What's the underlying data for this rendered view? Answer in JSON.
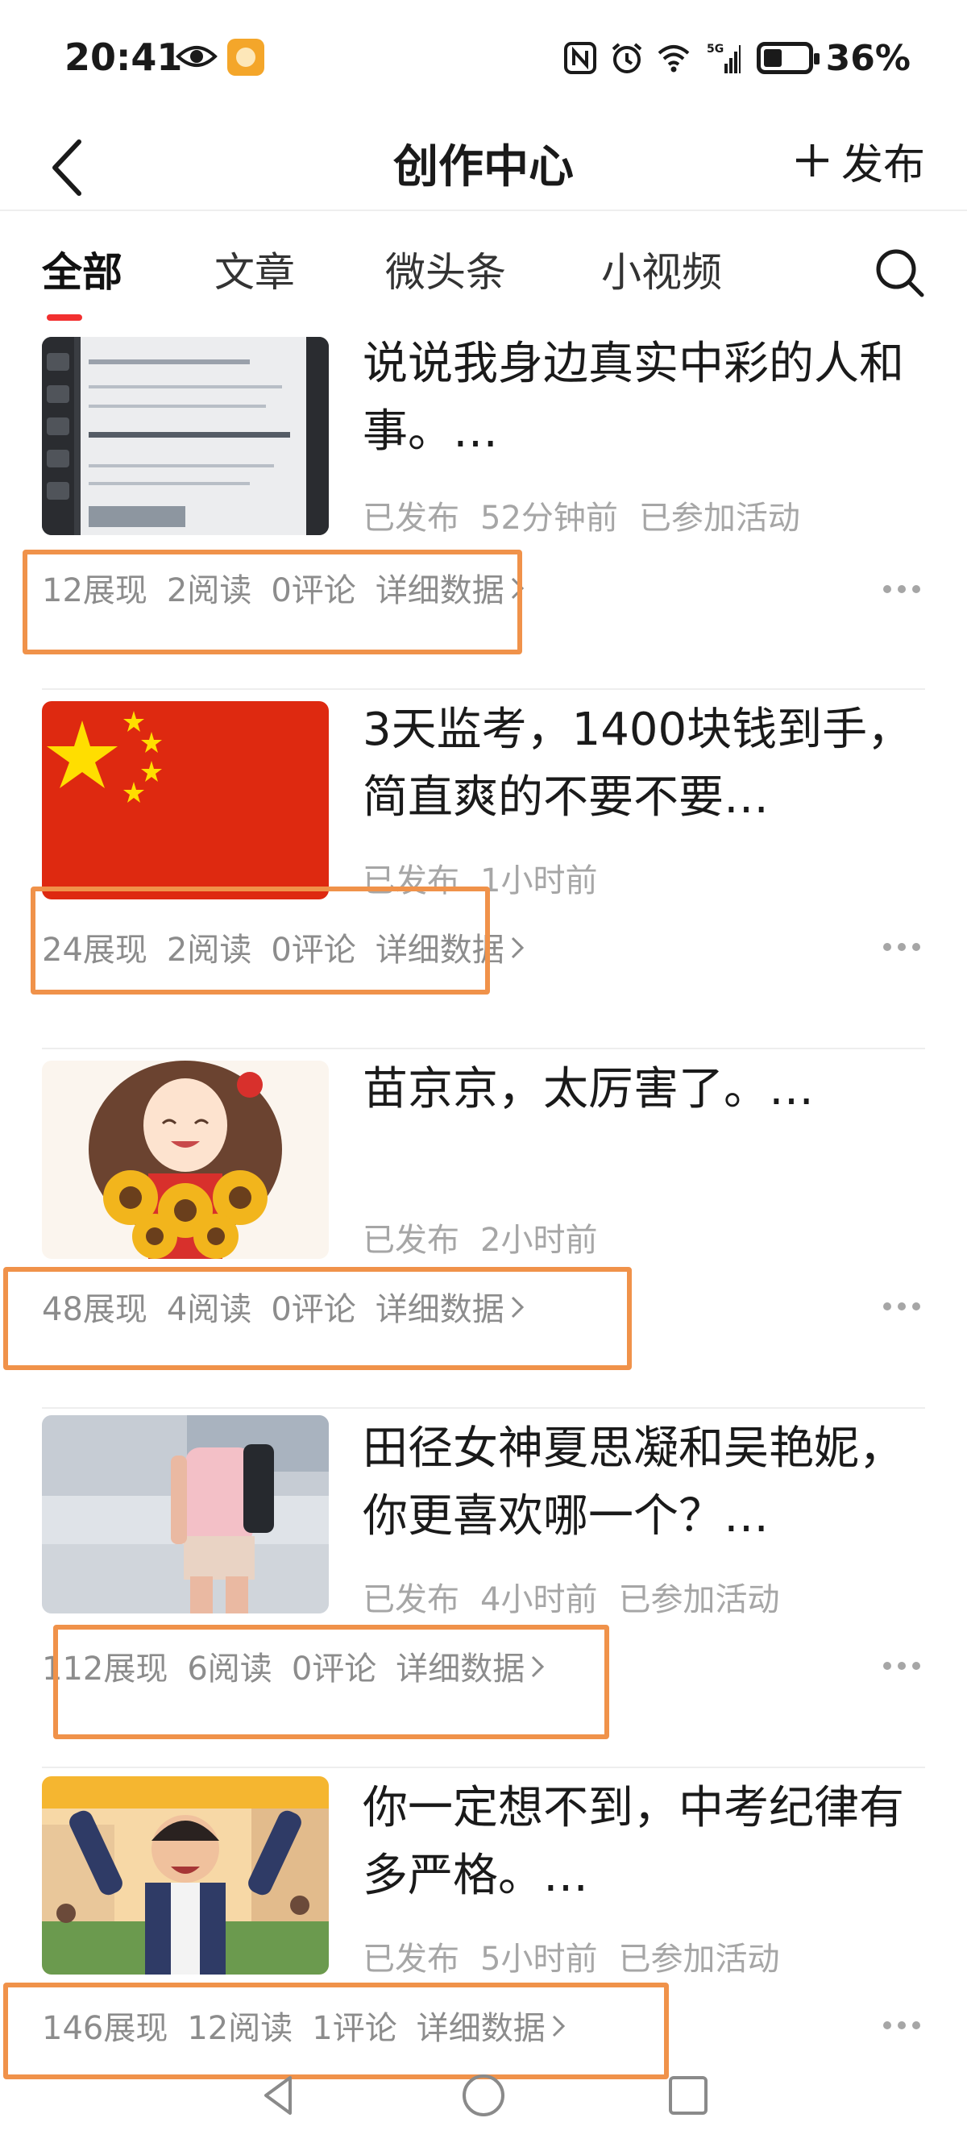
{
  "status_bar": {
    "time": "20:41",
    "battery": "36%",
    "network": "5G",
    "icons": [
      "eye-icon",
      "app-notification-icon",
      "nfc-icon",
      "alarm-icon",
      "wifi-icon",
      "signal-icon",
      "battery-icon"
    ]
  },
  "header": {
    "title": "创作中心",
    "publish_label": "发布"
  },
  "tabs": [
    {
      "label": "全部",
      "active": true
    },
    {
      "label": "文章",
      "active": false
    },
    {
      "label": "微头条",
      "active": false
    },
    {
      "label": "小视频",
      "active": false
    }
  ],
  "articles": [
    {
      "title": "说说我身边真实中彩的人和事。…",
      "status": "已发布",
      "time": "52分钟前",
      "activity": "已参加活动",
      "impressions": "12展现",
      "reads": "2阅读",
      "comments": "0评论",
      "details_link": "详细数据",
      "thumbnail": "lottery-ticket"
    },
    {
      "title": "3天监考，1400块钱到手，简直爽的不要不要…",
      "status": "已发布",
      "time": "1小时前",
      "activity": "",
      "impressions": "24展现",
      "reads": "2阅读",
      "comments": "0评论",
      "details_link": "详细数据",
      "thumbnail": "china-flag"
    },
    {
      "title": "苗京京，太厉害了。…",
      "status": "已发布",
      "time": "2小时前",
      "activity": "",
      "impressions": "48展现",
      "reads": "4阅读",
      "comments": "0评论",
      "details_link": "详细数据",
      "thumbnail": "girl-with-sunflowers"
    },
    {
      "title": "田径女神夏思凝和吴艳妮，你更喜欢哪一个？…",
      "status": "已发布",
      "time": "4小时前",
      "activity": "已参加活动",
      "impressions": "112展现",
      "reads": "6阅读",
      "comments": "0评论",
      "details_link": "详细数据",
      "thumbnail": "athlete-photo"
    },
    {
      "title": "你一定想不到，中考纪律有多严格。…",
      "status": "已发布",
      "time": "5小时前",
      "activity": "已参加活动",
      "impressions": "146展现",
      "reads": "12阅读",
      "comments": "1评论",
      "details_link": "详细数据",
      "thumbnail": "students-celebrating"
    }
  ],
  "colors": {
    "accent": "#f23030",
    "highlight": "#f0924a",
    "meta_text": "#a6a6a6"
  }
}
